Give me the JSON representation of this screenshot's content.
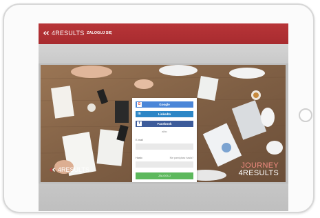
{
  "brand": {
    "name": "4RESULTS"
  },
  "nav": {
    "login": "ZALOGUJ SIĘ"
  },
  "login": {
    "google": "Google",
    "linkedin": "LinkedIn",
    "facebook": "Facebook",
    "or": "albo",
    "email_label": "E-mail",
    "password_label": "Hasło",
    "forgot": "Nie pamiętasz hasła?",
    "submit": "ZALOGUJ"
  },
  "hero": {
    "logo": "4RESULTS",
    "journey_line1": "JOURNEY",
    "journey_line2": "4RESULTS"
  },
  "colors": {
    "brand_red": "#b73538",
    "submit_green": "#5cb85c"
  }
}
